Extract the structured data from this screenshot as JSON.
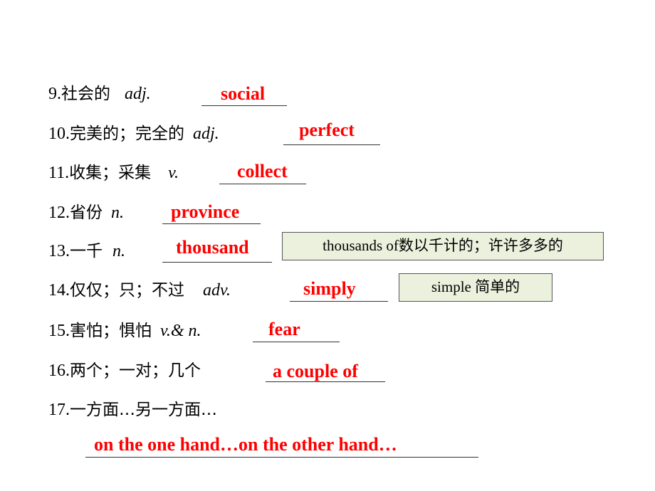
{
  "items": [
    {
      "num": "9.",
      "zh": "社会的",
      "pos": "adj.",
      "answer": "social"
    },
    {
      "num": "10.",
      "zh": "完美的；完全的",
      "pos": "adj.",
      "answer": "perfect"
    },
    {
      "num": "11.",
      "zh": "收集；采集",
      "pos": "v.",
      "answer": "collect"
    },
    {
      "num": "12.",
      "zh": "省份",
      "pos": "n.",
      "answer": "province"
    },
    {
      "num": "13.",
      "zh": "一千",
      "pos": "n.",
      "answer": "thousand"
    },
    {
      "num": "14.",
      "zh": "仅仅；只；不过",
      "pos": "adv.",
      "answer": "simply"
    },
    {
      "num": "15.",
      "zh": "害怕；惧怕",
      "pos": "v.& n.",
      "answer": "fear"
    },
    {
      "num": "16.",
      "zh": "两个；一对；几个",
      "pos": "",
      "answer": "a couple of"
    },
    {
      "num": "17.",
      "zh": "一方面…另一方面…",
      "pos": "",
      "answer": "on the one hand…on the other hand…"
    }
  ],
  "notes": {
    "thousand": {
      "en": "thousands of",
      "zh": "数以千计的；许许多多的"
    },
    "simply": {
      "en": "simple ",
      "zh": "简单的"
    }
  },
  "colors": {
    "answer": "#ff0000",
    "note_bg": "#ebf1dd"
  }
}
